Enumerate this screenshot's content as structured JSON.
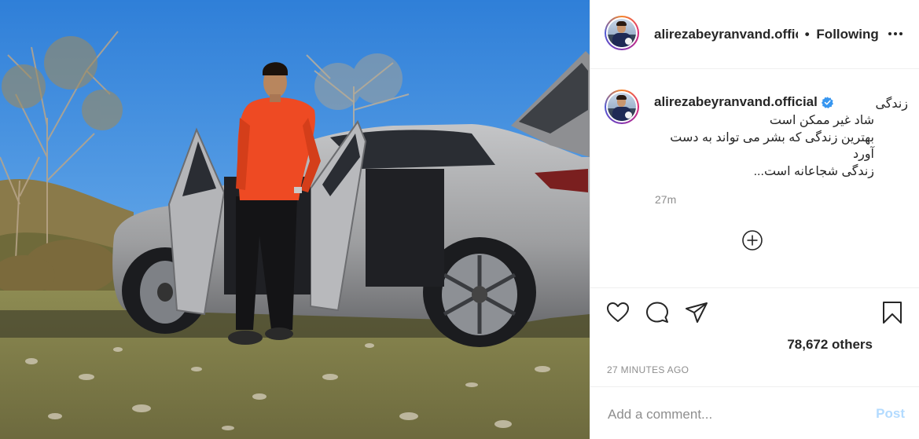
{
  "post": {
    "image_alt": "Man in orange jacket standing beside a silver Lexus SUV with doors open in a rural field",
    "colors": {
      "sky": "#3c8fe0",
      "jacket": "#f04a22",
      "car": "#a8a9ab",
      "ground": "#8a8a4c"
    }
  },
  "header": {
    "username": "alirezabeyranvand.offic",
    "separator": "•",
    "follow_status": "Following",
    "more_icon": "more-horizontal-icon"
  },
  "caption": {
    "username": "alirezabeyranvand.official",
    "verified_icon": "verified-badge-icon",
    "first_word": "زندگی",
    "lines": [
      "شاد غیر ممکن است",
      "بهترین زندگی که بشر می تواند به دست",
      "آورد",
      "زندگی شجاعانه است..."
    ],
    "timestamp": "27m",
    "more_replies_icon": "plus-circle-icon"
  },
  "actions": {
    "like_icon": "heart-icon",
    "comment_icon": "comment-icon",
    "share_icon": "send-icon",
    "save_icon": "bookmark-icon",
    "likes_text": "78,672 others",
    "time_ago": "27 MINUTES AGO"
  },
  "comment_box": {
    "placeholder": "Add a comment...",
    "post_label": "Post",
    "post_color": "#b3dbff"
  }
}
